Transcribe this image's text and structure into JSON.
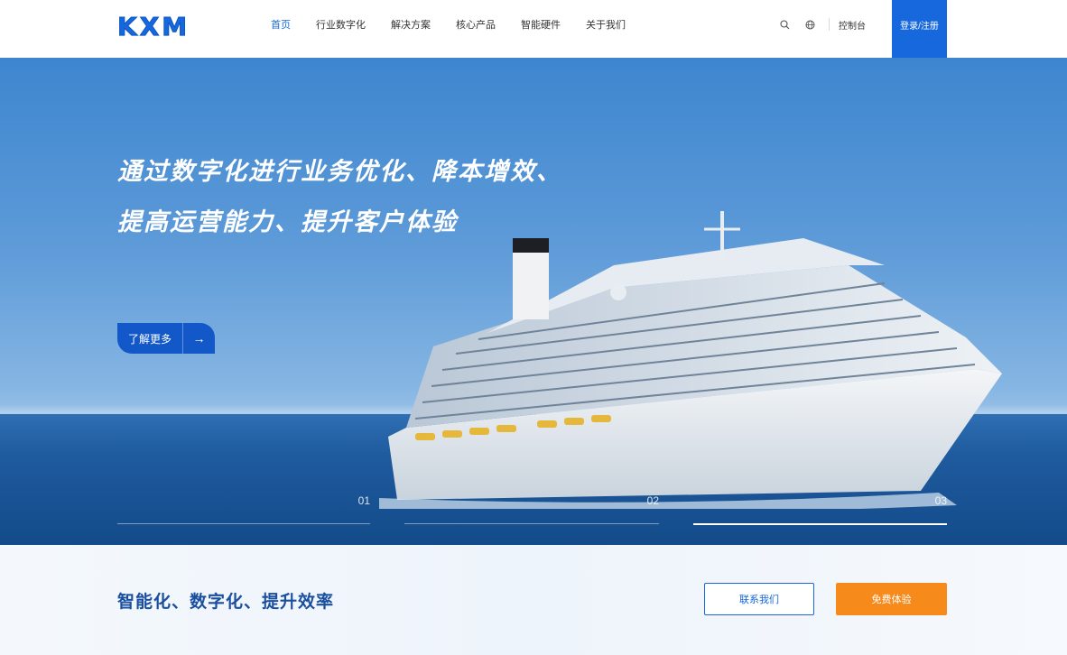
{
  "brand": {
    "logo_text": "KXM",
    "accent_color": "#1668dc",
    "orange_color": "#f68a1b"
  },
  "nav": {
    "items": [
      {
        "label": "首页",
        "active": true
      },
      {
        "label": "行业数字化",
        "active": false
      },
      {
        "label": "解决方案",
        "active": false
      },
      {
        "label": "核心产品",
        "active": false
      },
      {
        "label": "智能硬件",
        "active": false
      },
      {
        "label": "关于我们",
        "active": false
      }
    ],
    "search_icon": "search-icon",
    "language_icon": "globe-icon",
    "console_label": "控制台",
    "login_label": "登录/注册"
  },
  "hero": {
    "title_line1": "通过数字化进行业务优化、降本增效、",
    "title_line2": "提高运营能力、提升客户体验",
    "cta_label": "了解更多",
    "cta_icon": "arrow-right-icon",
    "slides": [
      {
        "number": "01",
        "active": false
      },
      {
        "number": "02",
        "active": false
      },
      {
        "number": "03",
        "active": true
      }
    ]
  },
  "band": {
    "title": "智能化、数字化、提升效率",
    "contact_label": "联系我们",
    "trial_label": "免费体验"
  }
}
